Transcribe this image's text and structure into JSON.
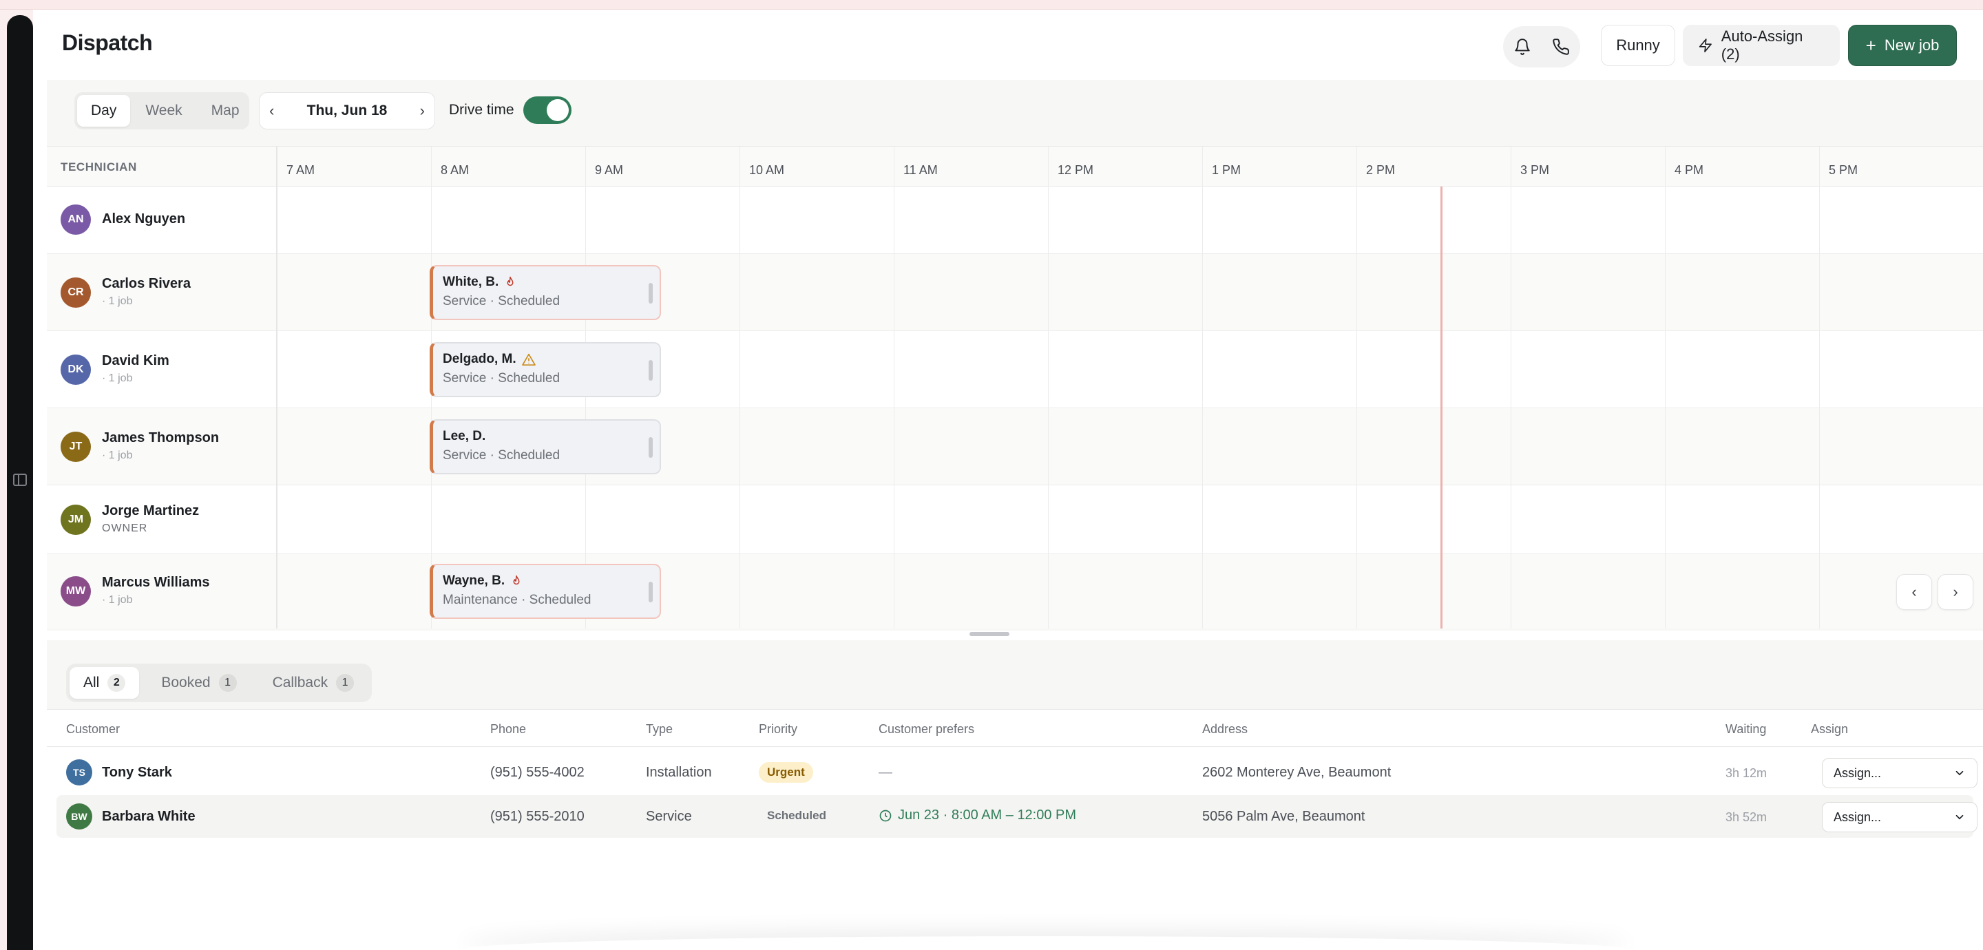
{
  "header": {
    "title": "Dispatch",
    "user_button": "Runny",
    "auto_assign": "Auto-Assign (2)",
    "new_job": "New job"
  },
  "toolbar": {
    "views": [
      "Day",
      "Week",
      "Map"
    ],
    "active_view": "Day",
    "date": "Thu, Jun 18",
    "drive_time_label": "Drive time",
    "drive_time_on": true
  },
  "schedule": {
    "technician_header": "TECHNICIAN",
    "hours": [
      "7 AM",
      "8 AM",
      "9 AM",
      "10 AM",
      "11 AM",
      "12 PM",
      "1 PM",
      "2 PM",
      "3 PM",
      "4 PM",
      "5 PM"
    ],
    "technicians": [
      {
        "initials": "AN",
        "name": "Alex Nguyen",
        "sub": "",
        "color": "#7a5aa6"
      },
      {
        "initials": "CR",
        "name": "Carlos Rivera",
        "sub": "· 1 job",
        "color": "#a3582d"
      },
      {
        "initials": "DK",
        "name": "David Kim",
        "sub": "· 1 job",
        "color": "#5567a8"
      },
      {
        "initials": "JT",
        "name": "James Thompson",
        "sub": "· 1 job",
        "color": "#8a6a17"
      },
      {
        "initials": "JM",
        "name": "Jorge Martinez",
        "sub": "OWNER",
        "color": "#6f741f"
      },
      {
        "initials": "MW",
        "name": "Marcus Williams",
        "sub": "· 1 job",
        "color": "#8a4d8a"
      }
    ],
    "jobs": [
      {
        "title": "White, B.",
        "sub": "Service · Scheduled",
        "icon": "flame-icon"
      },
      {
        "title": "Delgado, M.",
        "sub": "Service · Scheduled",
        "icon": "warning-icon"
      },
      {
        "title": "Lee, D.",
        "sub": "Service · Scheduled",
        "icon": ""
      },
      {
        "title": "Wayne, B.",
        "sub": "Maintenance · Scheduled",
        "icon": "flame-icon"
      }
    ]
  },
  "queue": {
    "tabs": [
      {
        "label": "All",
        "count": "2"
      },
      {
        "label": "Booked",
        "count": "1"
      },
      {
        "label": "Callback",
        "count": "1"
      }
    ],
    "columns": [
      "Customer",
      "Phone",
      "Type",
      "Priority",
      "Customer prefers",
      "Address",
      "Waiting",
      "Assign"
    ],
    "rows": [
      {
        "initials": "TS",
        "avatar_color": "#3f6f9f",
        "customer": "Tony Stark",
        "phone": "(951) 555-4002",
        "type": "Installation",
        "priority": "Urgent",
        "prefers": "—",
        "address": "2602 Monterey Ave, Beaumont",
        "waiting": "3h 12m",
        "assign": "Assign..."
      },
      {
        "initials": "BW",
        "avatar_color": "#3f7a45",
        "customer": "Barbara White",
        "phone": "(951) 555-2010",
        "type": "Service",
        "priority": "Scheduled",
        "prefers": "Jun 23 · 8:00 AM – 12:00 PM",
        "address": "5056 Palm Ave, Beaumont",
        "waiting": "3h 52m",
        "assign": "Assign..."
      }
    ]
  },
  "colors": {
    "brand_green": "#2f6d52",
    "now_line": "#ecb2ad",
    "job_accent": "#d27a4a"
  }
}
